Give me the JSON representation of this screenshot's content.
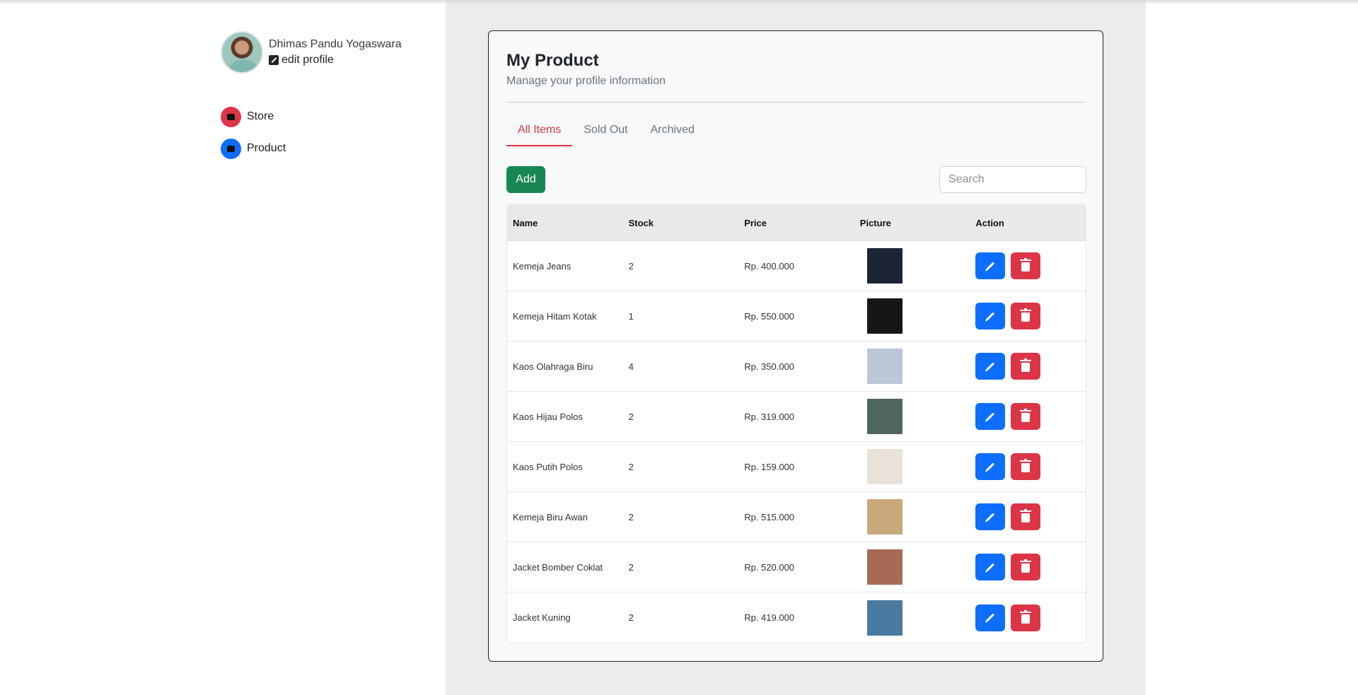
{
  "profile": {
    "name": "Dhimas Pandu Yogaswara",
    "edit_label": "edit profile"
  },
  "nav": {
    "items": [
      {
        "label": "Store",
        "color": "#dc3545",
        "icon": "store-icon"
      },
      {
        "label": "Product",
        "color": "#0d6efd",
        "icon": "box-icon"
      }
    ]
  },
  "card": {
    "title": "My Product",
    "subtitle": "Manage your profile information"
  },
  "tabs": [
    "All Items",
    "Sold Out",
    "Archived"
  ],
  "toolbar": {
    "add_label": "Add",
    "search_placeholder": "Search"
  },
  "table": {
    "headers": [
      "Name",
      "Stock",
      "Price",
      "Picture",
      "Action"
    ],
    "rows": [
      {
        "name": "Kemeja Jeans",
        "stock": "2",
        "price": "Rp. 400.000",
        "pic": "#1c2536"
      },
      {
        "name": "Kemeja Hitam Kotak",
        "stock": "1",
        "price": "Rp. 550.000",
        "pic": "#161616"
      },
      {
        "name": "Kaos Olahraga Biru",
        "stock": "4",
        "price": "Rp. 350.000",
        "pic": "#b9c7d6"
      },
      {
        "name": "Kaos Hijau Polos",
        "stock": "2",
        "price": "Rp. 319.000",
        "pic": "#4f6660"
      },
      {
        "name": "Kaos Putih Polos",
        "stock": "2",
        "price": "Rp. 159.000",
        "pic": "#e8e2d8"
      },
      {
        "name": "Kemeja Biru Awan",
        "stock": "2",
        "price": "Rp. 515.000",
        "pic": "#c9a87c"
      },
      {
        "name": "Jacket Bomber Coklat",
        "stock": "2",
        "price": "Rp. 520.000",
        "pic": "#a86a55"
      },
      {
        "name": "Jacket Kuning",
        "stock": "2",
        "price": "Rp. 419.000",
        "pic": "#4a7aa0"
      }
    ]
  }
}
